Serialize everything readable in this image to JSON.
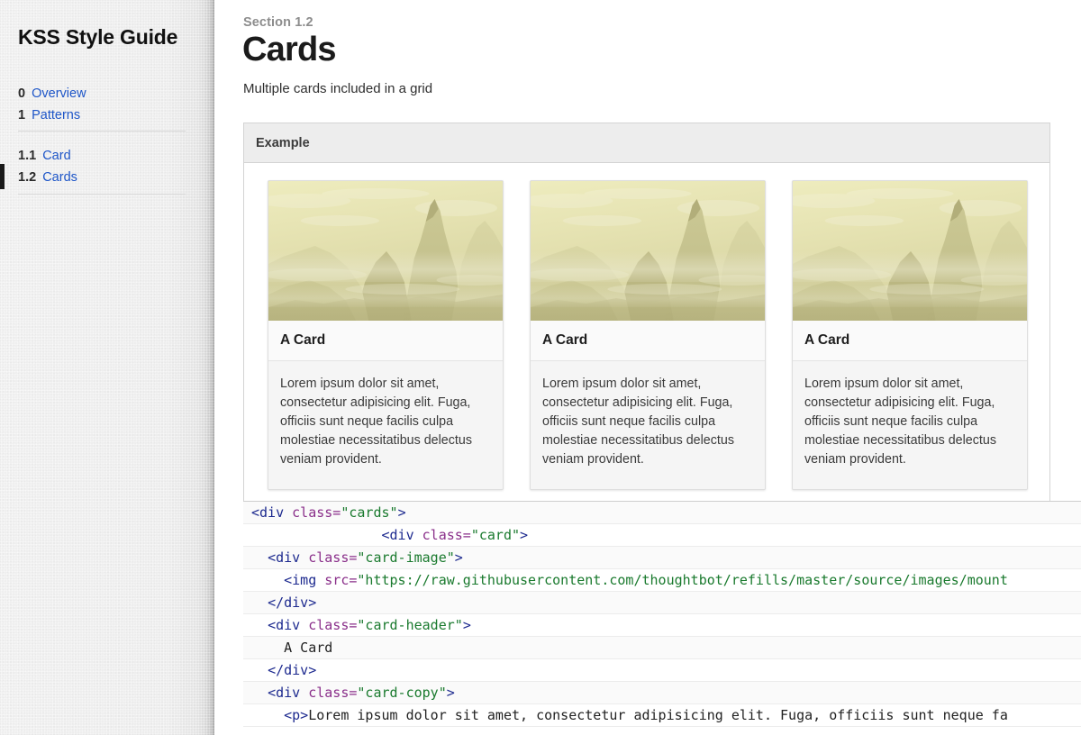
{
  "sidebar": {
    "title": "KSS Style Guide",
    "nav_top": [
      {
        "num": "0",
        "label": "Overview",
        "active": false
      },
      {
        "num": "1",
        "label": "Patterns",
        "active": false
      }
    ],
    "nav_bottom": [
      {
        "num": "1.1",
        "label": "Card",
        "active": false
      },
      {
        "num": "1.2",
        "label": "Cards",
        "active": true
      }
    ]
  },
  "main": {
    "section_label": "Section 1.2",
    "title": "Cards",
    "description": "Multiple cards included in a grid",
    "example": {
      "header_label": "Example",
      "cards": [
        {
          "title": "A Card",
          "copy": "Lorem ipsum dolor sit amet, consectetur adipisicing elit. Fuga, officiis sunt neque facilis culpa molestiae necessitatibus delectus veniam provident.",
          "image_alt": "misty-mountain-landscape"
        },
        {
          "title": "A Card",
          "copy": "Lorem ipsum dolor sit amet, consectetur adipisicing elit. Fuga, officiis sunt neque facilis culpa molestiae necessitatibus delectus veniam provident.",
          "image_alt": "misty-mountain-landscape"
        },
        {
          "title": "A Card",
          "copy": "Lorem ipsum dolor sit amet, consectetur adipisicing elit. Fuga, officiis sunt neque facilis culpa molestiae necessitatibus delectus veniam provident.",
          "image_alt": "misty-mountain-landscape"
        }
      ]
    },
    "code": {
      "lines": [
        [
          {
            "t": "tag",
            "v": "<div "
          },
          {
            "t": "attr",
            "v": "class="
          },
          {
            "t": "string",
            "v": "\"cards\""
          },
          {
            "t": "tag",
            "v": ">"
          }
        ],
        [
          {
            "t": "text",
            "v": "                "
          },
          {
            "t": "tag",
            "v": "<div "
          },
          {
            "t": "attr",
            "v": "class="
          },
          {
            "t": "string",
            "v": "\"card\""
          },
          {
            "t": "tag",
            "v": ">"
          }
        ],
        [
          {
            "t": "text",
            "v": "  "
          },
          {
            "t": "tag",
            "v": "<div "
          },
          {
            "t": "attr",
            "v": "class="
          },
          {
            "t": "string",
            "v": "\"card-image\""
          },
          {
            "t": "tag",
            "v": ">"
          }
        ],
        [
          {
            "t": "text",
            "v": "    "
          },
          {
            "t": "tag",
            "v": "<img "
          },
          {
            "t": "attr",
            "v": "src="
          },
          {
            "t": "string",
            "v": "\"https://raw.githubusercontent.com/thoughtbot/refills/master/source/images/mount"
          }
        ],
        [
          {
            "t": "text",
            "v": "  "
          },
          {
            "t": "tag",
            "v": "</div>"
          }
        ],
        [
          {
            "t": "text",
            "v": "  "
          },
          {
            "t": "tag",
            "v": "<div "
          },
          {
            "t": "attr",
            "v": "class="
          },
          {
            "t": "string",
            "v": "\"card-header\""
          },
          {
            "t": "tag",
            "v": ">"
          }
        ],
        [
          {
            "t": "text",
            "v": "    A Card"
          }
        ],
        [
          {
            "t": "text",
            "v": "  "
          },
          {
            "t": "tag",
            "v": "</div>"
          }
        ],
        [
          {
            "t": "text",
            "v": "  "
          },
          {
            "t": "tag",
            "v": "<div "
          },
          {
            "t": "attr",
            "v": "class="
          },
          {
            "t": "string",
            "v": "\"card-copy\""
          },
          {
            "t": "tag",
            "v": ">"
          }
        ],
        [
          {
            "t": "text",
            "v": "    "
          },
          {
            "t": "tag",
            "v": "<p>"
          },
          {
            "t": "text",
            "v": "Lorem ipsum dolor sit amet, consectetur adipisicing elit. Fuga, officiis sunt neque fa"
          }
        ]
      ]
    }
  },
  "colors": {
    "link": "#1e56c8",
    "sidebar_bg": "#eeeeee",
    "panel_header_bg": "#ededed",
    "card_bg": "#f5f5f5",
    "active_marker": "#1a1a1a",
    "code_tag": "#1d2a8f",
    "code_attr": "#8a2f8a",
    "code_string": "#1a7a2e",
    "image_tint": "#cfcc9a"
  }
}
